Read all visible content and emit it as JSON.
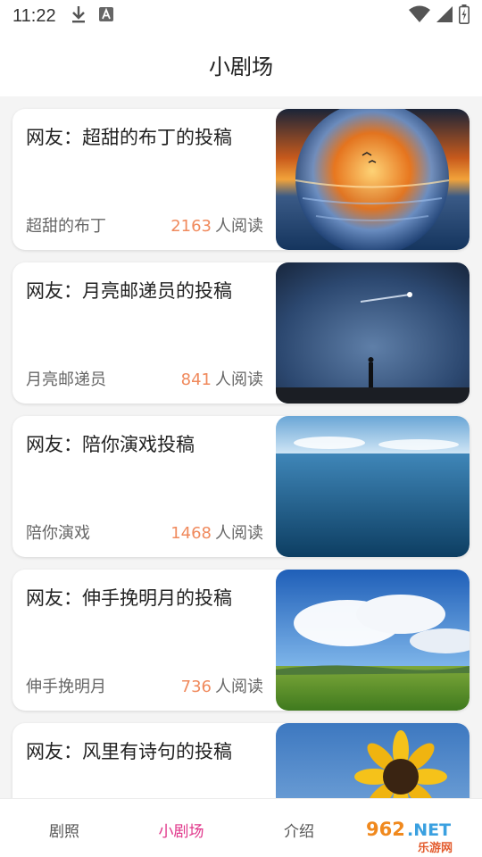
{
  "status_bar": {
    "time": "11:22",
    "left_icons": [
      "download-icon",
      "text-a-icon"
    ],
    "right_icons": [
      "wifi-icon",
      "signal-icon",
      "battery-icon"
    ]
  },
  "header": {
    "title": "小剧场"
  },
  "feed": {
    "read_suffix": "人阅读",
    "items": [
      {
        "title": "网友：超甜的布丁的投稿",
        "author": "超甜的布丁",
        "reads": "2163",
        "thumbnail": "sunset-glass-sphere"
      },
      {
        "title": "网友：月亮邮递员的投稿",
        "author": "月亮邮递员",
        "reads": "841",
        "thumbnail": "meteor-night-sky"
      },
      {
        "title": "网友：陪你演戏投稿",
        "author": "陪你演戏",
        "reads": "1468",
        "thumbnail": "blue-ocean"
      },
      {
        "title": "网友：伸手挽明月的投稿",
        "author": "伸手挽明月",
        "reads": "736",
        "thumbnail": "grassland-clouds"
      },
      {
        "title": "网友：风里有诗句的投稿",
        "author": "",
        "reads": "",
        "thumbnail": "sunflower-sky"
      }
    ]
  },
  "bottom_nav": {
    "tabs": [
      {
        "label": "剧照",
        "active": false
      },
      {
        "label": "小剧场",
        "active": true
      },
      {
        "label": "介绍",
        "active": false
      }
    ],
    "active_color": "#e0368a"
  },
  "watermark": {
    "text_top": "962.NET",
    "text_bottom": "乐游网"
  },
  "colors": {
    "read_count": "#f08a5d",
    "accent": "#e0368a"
  }
}
